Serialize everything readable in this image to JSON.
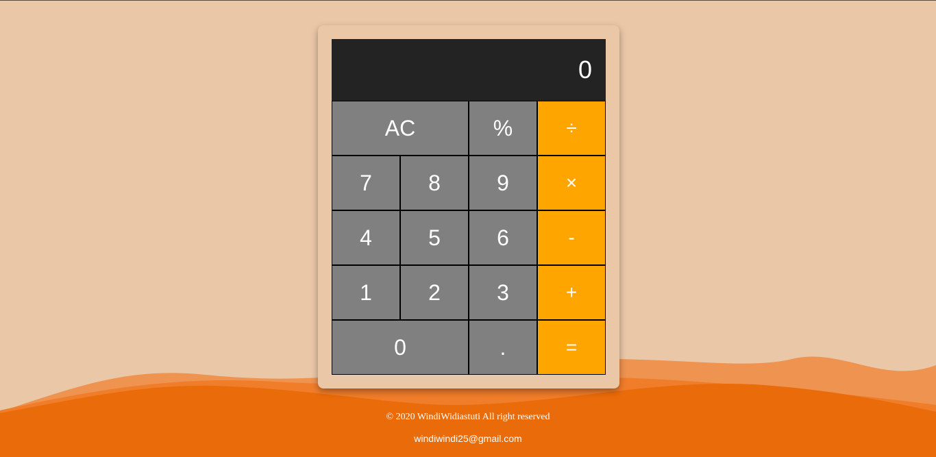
{
  "display": {
    "value": "0"
  },
  "keys": {
    "clear": "AC",
    "percent": "%",
    "divide": "÷",
    "seven": "7",
    "eight": "8",
    "nine": "9",
    "multiply": "×",
    "four": "4",
    "five": "5",
    "six": "6",
    "subtract": "-",
    "one": "1",
    "two": "2",
    "three": "3",
    "add": "+",
    "zero": "0",
    "decimal": ".",
    "equals": "="
  },
  "footer": {
    "copyright": "© 2020 WindiWidiastuti All right reserved",
    "email": "windiwindi25@gmail.com"
  },
  "colors": {
    "background": "#EAC7A7",
    "display": "#232323",
    "key": "#808080",
    "operator": "#FFA500",
    "wave_dark": "#EA6B0A",
    "wave_mid": "#F07D2A",
    "wave_light": "#EE9350"
  }
}
